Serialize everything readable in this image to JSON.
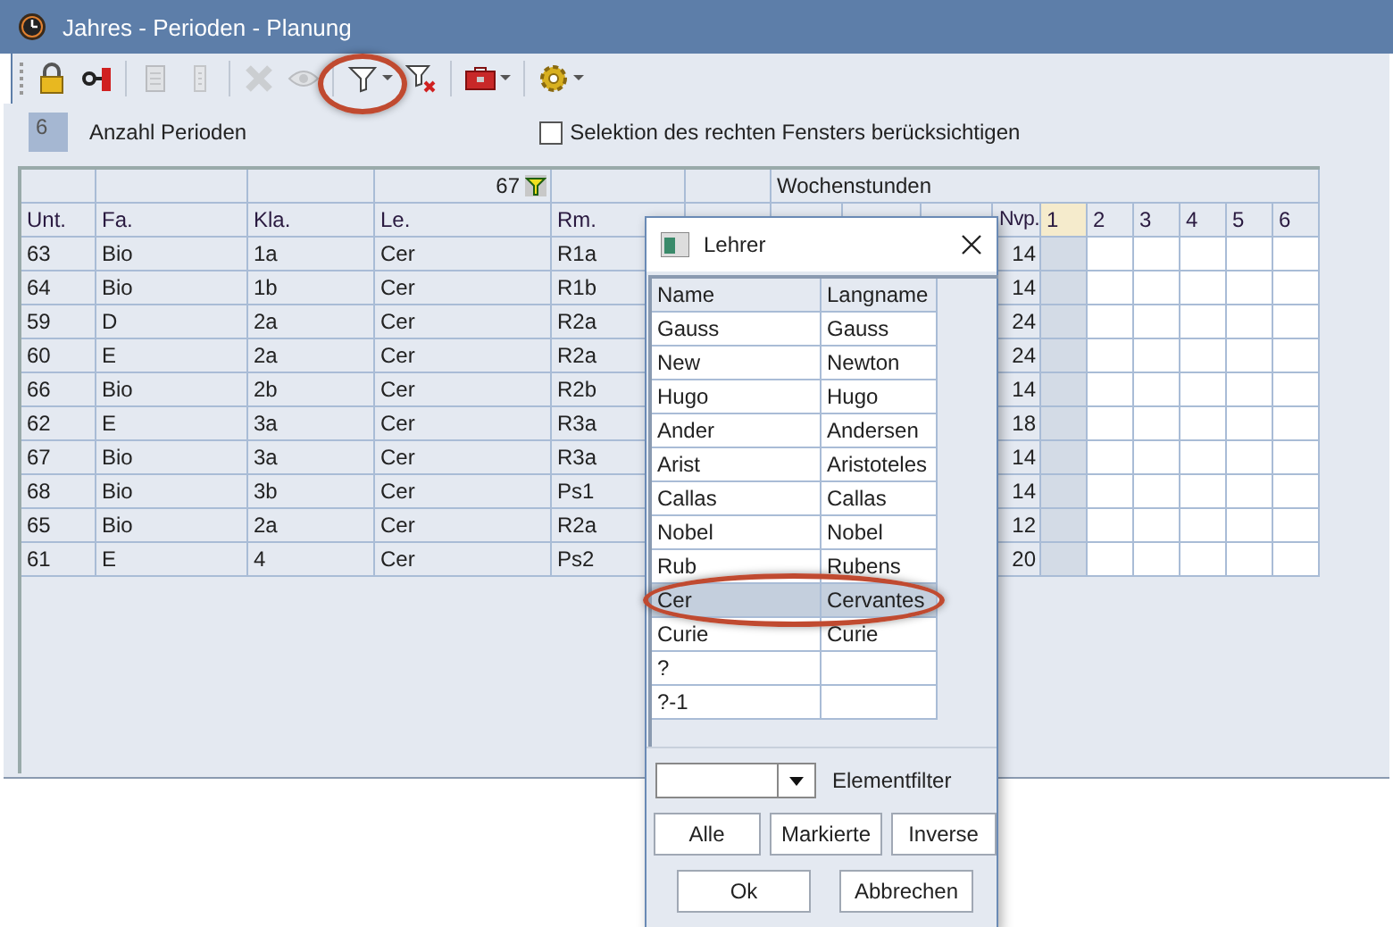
{
  "window": {
    "title": "Jahres - Perioden - Planung"
  },
  "toolbar": [
    {
      "kind": "lock",
      "disabled": false
    },
    {
      "kind": "key",
      "disabled": false
    },
    {
      "kind": "calculator",
      "disabled": true
    },
    {
      "kind": "clipboard",
      "disabled": true
    },
    {
      "kind": "delete",
      "disabled": true
    },
    {
      "kind": "eye",
      "disabled": true
    },
    {
      "kind": "filter",
      "disabled": false,
      "menu": true
    },
    {
      "kind": "filter-off",
      "disabled": false
    },
    {
      "kind": "toolbox",
      "disabled": false,
      "menu": true
    },
    {
      "kind": "gear",
      "disabled": false,
      "menu": true
    }
  ],
  "periods": {
    "count": "6",
    "label": "Anzahl Perioden"
  },
  "selection": {
    "label": "Selektion des rechten Fensters berücksichtigen",
    "checked": false
  },
  "table": {
    "filter_count": "67",
    "group_header": "Wochenstunden",
    "columns": [
      "Unt.",
      "Fa.",
      "Kla.",
      "Le.",
      "Rm."
    ],
    "nvp_label": "Nvp.",
    "periods": [
      {
        "label": "1",
        "selected": true
      },
      {
        "label": "2",
        "selected": false
      },
      {
        "label": "3",
        "selected": false
      },
      {
        "label": "4",
        "selected": false
      },
      {
        "label": "5",
        "selected": false
      },
      {
        "label": "6",
        "selected": false
      }
    ],
    "rows": [
      {
        "cells": [
          "63",
          "Bio",
          "1a",
          "Cer",
          "R1a"
        ],
        "nvp": "14"
      },
      {
        "cells": [
          "64",
          "Bio",
          "1b",
          "Cer",
          "R1b"
        ],
        "nvp": "14"
      },
      {
        "cells": [
          "59",
          "D",
          "2a",
          "Cer",
          "R2a"
        ],
        "nvp": "24"
      },
      {
        "cells": [
          "60",
          "E",
          "2a",
          "Cer",
          "R2a"
        ],
        "nvp": "24"
      },
      {
        "cells": [
          "66",
          "Bio",
          "2b",
          "Cer",
          "R2b"
        ],
        "nvp": "14"
      },
      {
        "cells": [
          "62",
          "E",
          "3a",
          "Cer",
          "R3a"
        ],
        "nvp": "18"
      },
      {
        "cells": [
          "67",
          "Bio",
          "3a",
          "Cer",
          "R3a"
        ],
        "nvp": "14"
      },
      {
        "cells": [
          "68",
          "Bio",
          "3b",
          "Cer",
          "Ps1"
        ],
        "nvp": "14"
      },
      {
        "cells": [
          "65",
          "Bio",
          "2a",
          "Cer",
          "R2a"
        ],
        "nvp": "12"
      },
      {
        "cells": [
          "61",
          "E",
          "4",
          "Cer",
          "Ps2"
        ],
        "nvp": "20"
      }
    ]
  },
  "dialog": {
    "title": "Lehrer",
    "columns": [
      "Name",
      "Langname"
    ],
    "items": [
      {
        "name": "Gauss",
        "long_name": "Gauss",
        "selected": false
      },
      {
        "name": "New",
        "long_name": "Newton",
        "selected": false
      },
      {
        "name": "Hugo",
        "long_name": "Hugo",
        "selected": false
      },
      {
        "name": "Ander",
        "long_name": "Andersen",
        "selected": false
      },
      {
        "name": "Arist",
        "long_name": "Aristoteles",
        "selected": false
      },
      {
        "name": "Callas",
        "long_name": "Callas",
        "selected": false
      },
      {
        "name": "Nobel",
        "long_name": "Nobel",
        "selected": false
      },
      {
        "name": "Rub",
        "long_name": "Rubens",
        "selected": false
      },
      {
        "name": "Cer",
        "long_name": "Cervantes",
        "selected": true
      },
      {
        "name": "Curie",
        "long_name": "Curie",
        "selected": false
      },
      {
        "name": "?",
        "selected": false
      },
      {
        "name": "?-1",
        "selected": false
      }
    ],
    "filter_label": "Elementfilter",
    "buttons": [
      "Alle",
      "Markierte",
      "Inverse"
    ],
    "ok": "Ok",
    "cancel": "Abbrechen"
  }
}
